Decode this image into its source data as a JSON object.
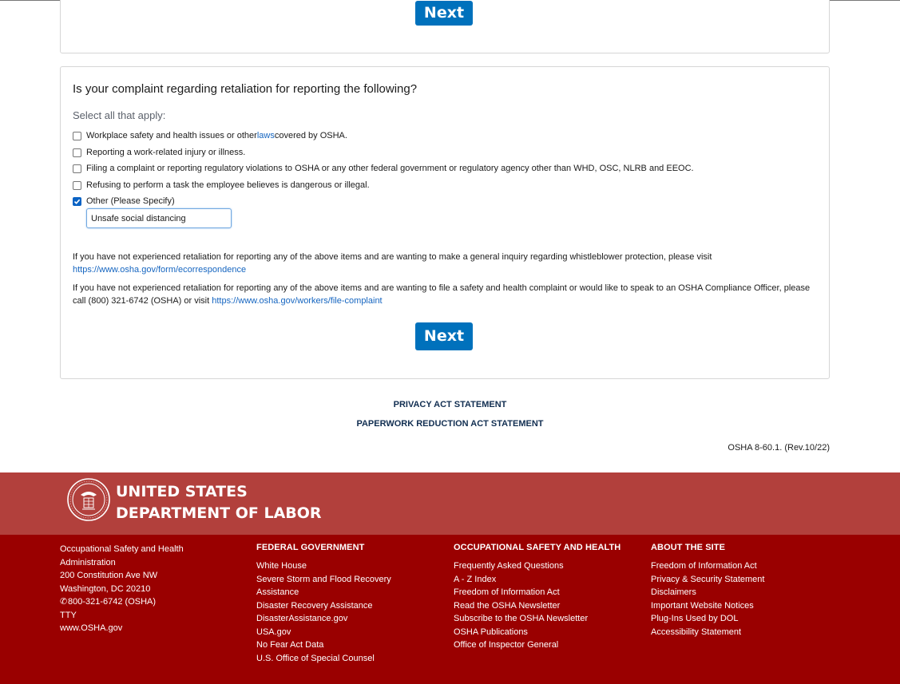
{
  "buttons": {
    "next_top": "Next",
    "next_bottom": "Next"
  },
  "question": {
    "title": "Is your complaint regarding retaliation for reporting the following?",
    "instruction": "Select all that apply:",
    "options": [
      {
        "label_before": "Workplace safety and health issues or other ",
        "link": "laws",
        "label_after": " covered by OSHA.",
        "checked": false
      },
      {
        "label": "Reporting a work-related injury or illness.",
        "checked": false
      },
      {
        "label": "Filing a complaint or reporting regulatory violations to OSHA or any other federal government or regulatory agency other than WHD, OSC, NLRB and EEOC.",
        "checked": false
      },
      {
        "label": "Refusing to perform a task the employee believes is dangerous or illegal.",
        "checked": false
      },
      {
        "label": "Other (Please Specify)",
        "checked": true
      }
    ],
    "other_value": "Unsafe social distancing"
  },
  "info": {
    "p1_text": "If you have not experienced retaliation for reporting any of the above items and are wanting to make a general inquiry regarding whistleblower protection, please visit",
    "p1_link": "https://www.osha.gov/form/ecorrespondence",
    "p2_text": "If you have not experienced retaliation for reporting any of the above items and are wanting to file a safety and health complaint or would like to speak to an OSHA Compliance Officer, please call (800) 321-6742 (OSHA) or visit",
    "p2_link": "https://www.osha.gov/workers/file-complaint"
  },
  "footer_links": {
    "privacy": "PRIVACY ACT STATEMENT",
    "paperwork": "PAPERWORK REDUCTION ACT STATEMENT"
  },
  "form_number": "OSHA 8-60.1. (Rev.10/22)",
  "dol": {
    "line1": "UNITED STATES",
    "line2": "DEPARTMENT OF LABOR"
  },
  "footer": {
    "address": {
      "lines": [
        "Occupational Safety and Health",
        "Administration",
        "200 Constitution Ave NW",
        "Washington, DC 20210"
      ],
      "phone": "800-321-6742 (OSHA)",
      "tty": "TTY",
      "website": "www.OSHA.gov"
    },
    "federal_government": {
      "heading": "FEDERAL GOVERNMENT",
      "items": [
        "White House",
        "Severe Storm and Flood Recovery",
        "Assistance",
        "Disaster Recovery Assistance",
        "DisasterAssistance.gov",
        "USA.gov",
        "No Fear Act Data",
        "U.S. Office of Special Counsel"
      ]
    },
    "osh": {
      "heading": "OCCUPATIONAL SAFETY AND HEALTH",
      "items": [
        "Frequently Asked Questions",
        "A - Z Index",
        "Freedom of Information Act",
        "Read the OSHA Newsletter",
        "Subscribe to the OSHA Newsletter",
        "OSHA Publications",
        "Office of Inspector General"
      ]
    },
    "about": {
      "heading": "ABOUT THE SITE",
      "items": [
        "Freedom of Information Act",
        "Privacy & Security Statement",
        "Disclaimers",
        "Important Website Notices",
        "Plug-Ins Used by DOL",
        "Accessibility Statement"
      ]
    }
  },
  "colors": {
    "primary_button": "#0071bc",
    "banner": "#b2403c",
    "footer": "#9a0000",
    "link": "#1565c0"
  }
}
